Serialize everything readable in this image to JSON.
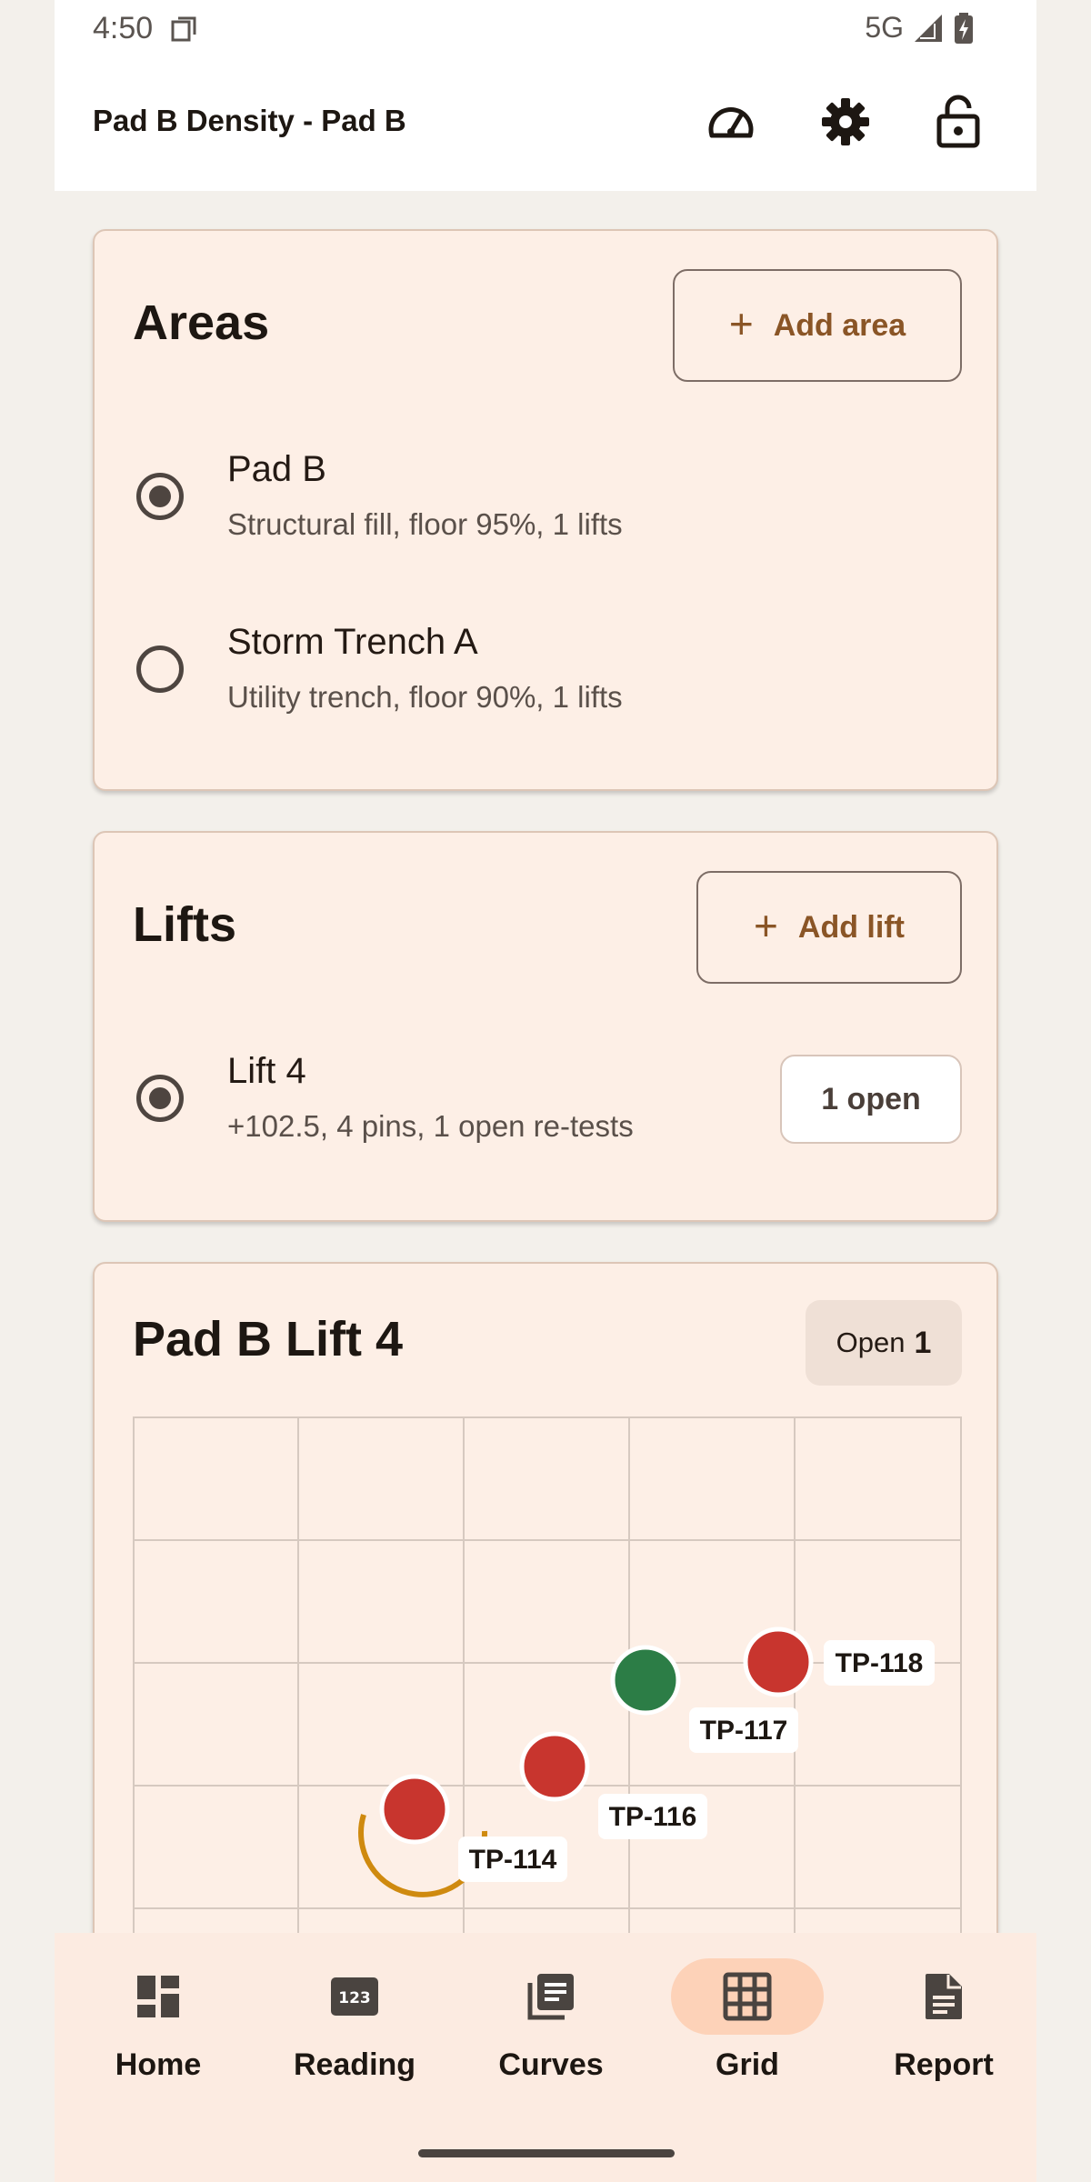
{
  "status": {
    "time": "4:50",
    "network": "5G"
  },
  "app_bar": {
    "title": "Pad B Density - Pad B"
  },
  "areas": {
    "title": "Areas",
    "add_label": "Add area",
    "items": [
      {
        "name": "Pad B",
        "detail": "Structural fill, floor 95%, 1 lifts",
        "selected": true
      },
      {
        "name": "Storm Trench A",
        "detail": "Utility trench, floor 90%, 1 lifts",
        "selected": false
      }
    ]
  },
  "lifts": {
    "title": "Lifts",
    "add_label": "Add lift",
    "items": [
      {
        "name": "Lift 4",
        "detail": "+102.5, 4 pins, 1 open re-tests",
        "badge": "1 open",
        "selected": true
      }
    ]
  },
  "grid_card": {
    "title": "Pad B Lift 4",
    "open_label": "Open",
    "open_count": "1",
    "pins": [
      {
        "label": "TP-114",
        "status": "fail",
        "color": "#c8352e",
        "selected": true
      },
      {
        "label": "TP-116",
        "status": "fail",
        "color": "#c8352e",
        "selected": false
      },
      {
        "label": "TP-117",
        "status": "pass",
        "color": "#2c7d46",
        "selected": false
      },
      {
        "label": "TP-118",
        "status": "fail",
        "color": "#c8352e",
        "selected": false
      }
    ],
    "selection_ring_color": "#cf8a0f"
  },
  "nav": {
    "items": [
      {
        "label": "Home",
        "icon": "dashboard-icon",
        "active": false
      },
      {
        "label": "Reading",
        "icon": "numbers-icon",
        "active": false
      },
      {
        "label": "Curves",
        "icon": "library-books-icon",
        "active": false
      },
      {
        "label": "Grid",
        "icon": "grid-icon",
        "active": true
      },
      {
        "label": "Report",
        "icon": "document-icon",
        "active": false
      }
    ]
  }
}
